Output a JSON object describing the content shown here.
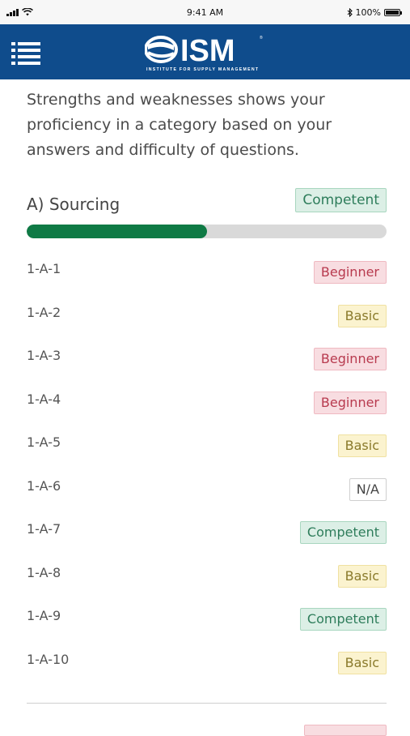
{
  "status_bar": {
    "time": "9:41 AM",
    "battery": "100%"
  },
  "header": {
    "logo_text": "ISM",
    "logo_subtext": "INSTITUTE FOR SUPPLY MANAGEMENT"
  },
  "intro_text": "Strengths and weaknesses shows your proficiency in a category based on your answers and difficulty of questions.",
  "category": {
    "title": "A) Sourcing",
    "level": "Competent",
    "progress": 0.5
  },
  "items": [
    {
      "code": "1-A-1",
      "level": "Beginner",
      "style": "beginner"
    },
    {
      "code": "1-A-2",
      "level": "Basic",
      "style": "basic"
    },
    {
      "code": "1-A-3",
      "level": "Beginner",
      "style": "beginner"
    },
    {
      "code": "1-A-4",
      "level": "Beginner",
      "style": "beginner"
    },
    {
      "code": "1-A-5",
      "level": "Basic",
      "style": "basic"
    },
    {
      "code": "1-A-6",
      "level": "N/A",
      "style": "na"
    },
    {
      "code": "1-A-7",
      "level": "Competent",
      "style": "competent"
    },
    {
      "code": "1-A-8",
      "level": "Basic",
      "style": "basic"
    },
    {
      "code": "1-A-9",
      "level": "Competent",
      "style": "competent"
    },
    {
      "code": "1-A-10",
      "level": "Basic",
      "style": "basic"
    }
  ],
  "colors": {
    "header_blue": "#0f4c8c",
    "progress_green": "#0f7a45",
    "competent": "#2e7d5b",
    "beginner": "#b83b4f",
    "basic": "#8a7a2b"
  }
}
